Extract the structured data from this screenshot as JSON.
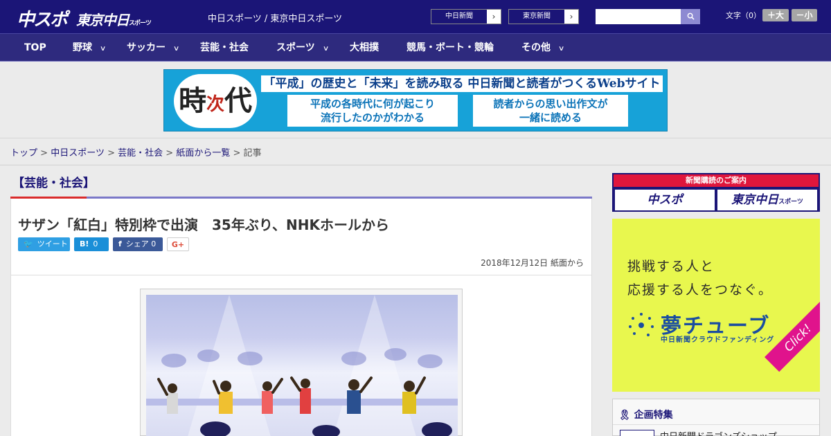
{
  "header": {
    "logo_chunichi": "中スポ",
    "logo_tokyo": "東京中日",
    "logo_tokyo_sub": "スポーツ",
    "site_title": "中日スポーツ / 東京中日スポーツ",
    "paper_links": [
      "中日新聞",
      "東京新聞"
    ],
    "search_button": "🔍",
    "font_size_label": "文字（0）",
    "font_larger": "＋大",
    "font_smaller": "－小"
  },
  "nav": {
    "items": [
      {
        "label": "TOP",
        "dropdown": false
      },
      {
        "label": "野球",
        "dropdown": true
      },
      {
        "label": "サッカー",
        "dropdown": true
      },
      {
        "label": "芸能・社会",
        "dropdown": false
      },
      {
        "label": "スポーツ",
        "dropdown": true
      },
      {
        "label": "大相撲",
        "dropdown": false
      },
      {
        "label": "競馬・ボート・競輪",
        "dropdown": false
      },
      {
        "label": "その他",
        "dropdown": true
      }
    ]
  },
  "banner": {
    "kanji_top": "時",
    "kanji_mid": "次",
    "kanji_bottom": "代",
    "headline": "「平成」の歴史と「未来」を読み取る 中日新聞と読者がつくるWebサイト",
    "box_left_1": "平成の各時代に何が起こり",
    "box_left_2": "流行したのかがわかる",
    "box_right_1": "読者からの思い出作文が",
    "box_right_2": "一緒に読める"
  },
  "breadcrumb": {
    "items": [
      "トップ",
      "中日スポーツ",
      "芸能・社会",
      "紙面から一覧"
    ],
    "current": "記事",
    "separator": ">"
  },
  "article": {
    "category": "【芸能・社会】",
    "title": "サザン「紅白」特別枠で出演　35年ぶり、NHKホールから",
    "share": {
      "tweet": "ツイート",
      "hatena_count": "0",
      "facebook_label": "シェア",
      "facebook_count": "0",
      "gplus": "G+"
    },
    "date": "2018年12月12日 紙面から"
  },
  "sidebar": {
    "subscribe_header": "新聞購読のご案内",
    "subscribe_chunichi": "中スポ",
    "subscribe_tokyo": "東京中日",
    "subscribe_tokyo_sub": "スポーツ",
    "ad_line1": "挑戦する人と",
    "ad_line2": "応援する人をつなぐ。",
    "ad_brand": "夢チューブ",
    "ad_brand_sub": "中日新聞クラウドファンディング",
    "ad_click": "Click!",
    "feature_header": "企画特集",
    "feature_item": "中日新聞ドラゴンズショップ"
  },
  "colors": {
    "header_bg": "#1b1577",
    "nav_bg": "#2e2a7e",
    "accent_red": "#d92b2b",
    "ad_yellow": "#e8f74e"
  }
}
